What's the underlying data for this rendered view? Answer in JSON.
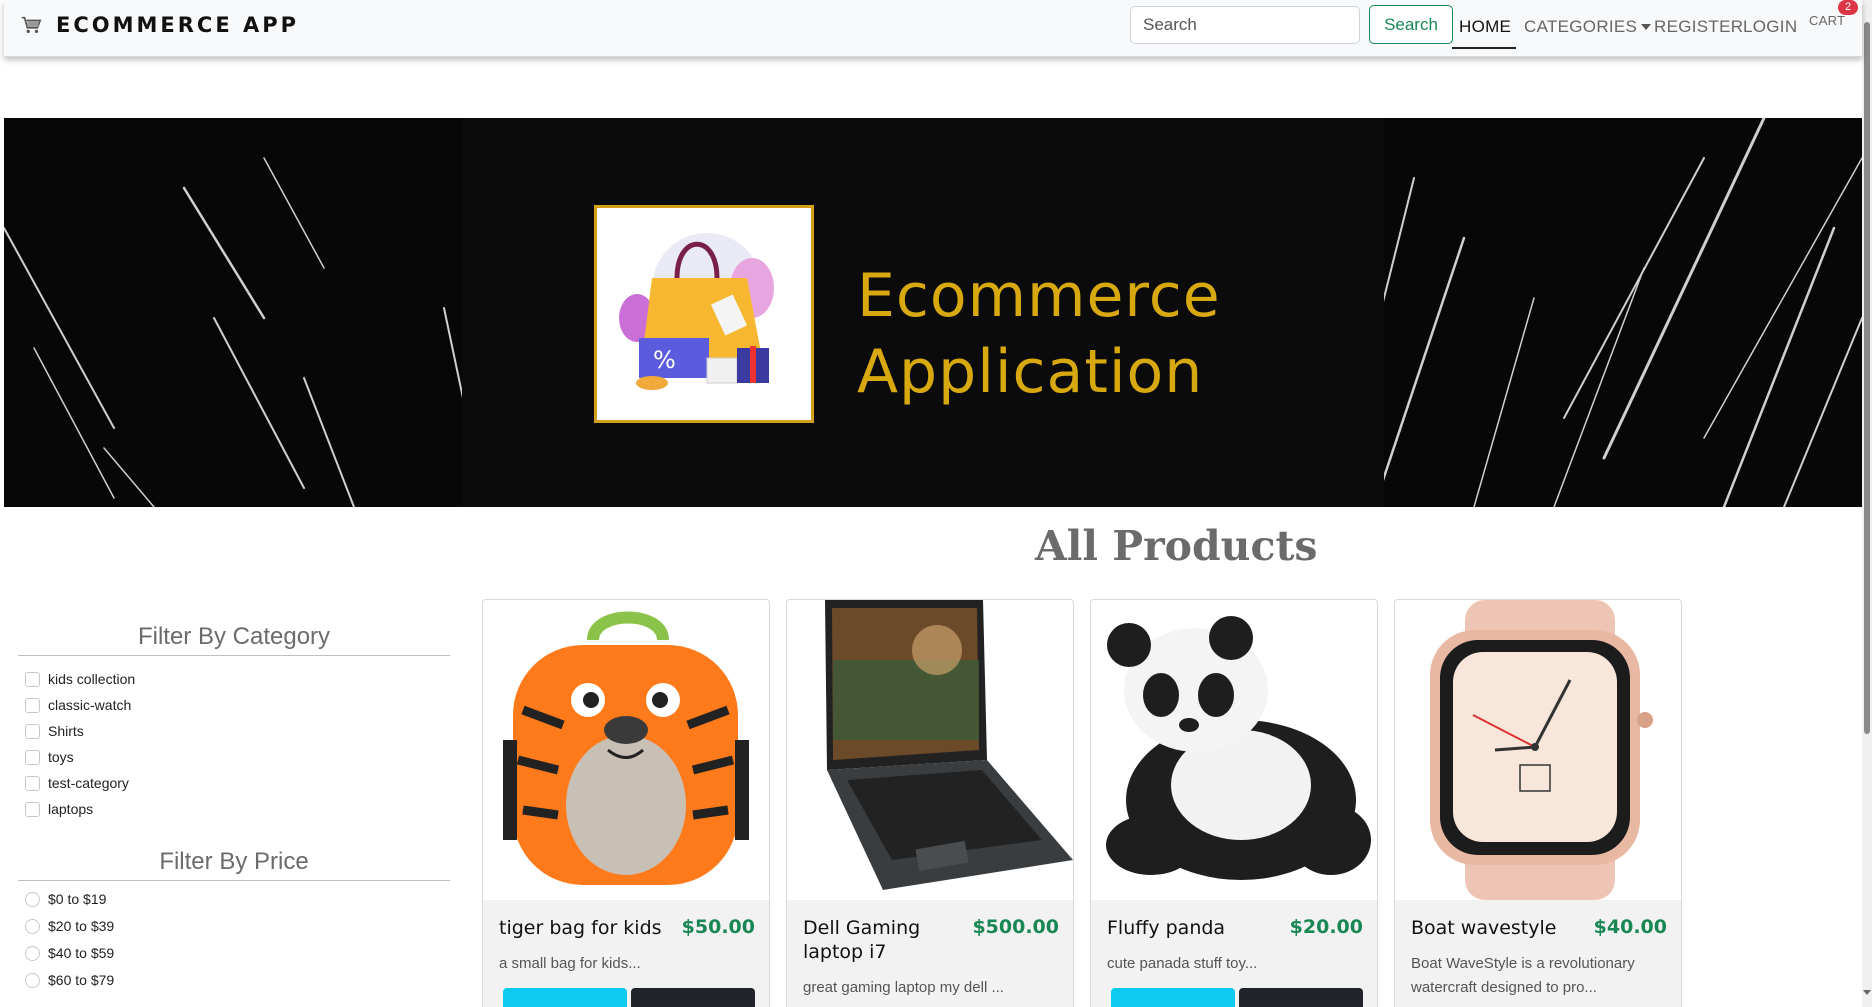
{
  "navbar": {
    "brand": "ECOMMERCE APP",
    "search_placeholder": "Search",
    "search_button": "Search",
    "links": {
      "home": "HOME",
      "categories": "CATEGORIES",
      "register": "REGISTER",
      "login": "LOGIN",
      "cart": "CART"
    },
    "cart_count": "2"
  },
  "banner": {
    "title_line1": "Ecommerce",
    "title_line2": "Application"
  },
  "main": {
    "heading": "All Products"
  },
  "filters": {
    "category_heading": "Filter By Category",
    "categories": [
      "kids collection",
      "classic-watch",
      "Shirts",
      "toys",
      "test-category",
      "laptops"
    ],
    "price_heading": "Filter By Price",
    "prices": [
      "$0 to $19",
      "$20 to $39",
      "$40 to $59",
      "$60 to $79"
    ]
  },
  "products": [
    {
      "name": "tiger bag for kids",
      "price": "$50.00",
      "description": "a small bag for kids..."
    },
    {
      "name": "Dell Gaming laptop i7",
      "price": "$500.00",
      "description": "great gaming laptop my dell ..."
    },
    {
      "name": "Fluffy panda",
      "price": "$20.00",
      "description": "cute panada stuff toy..."
    },
    {
      "name": "Boat wavestyle",
      "price": "$40.00",
      "description": "Boat WaveStyle is a revolutionary watercraft designed to pro..."
    }
  ],
  "colors": {
    "accent_green": "#198754",
    "banner_gold": "#d8a80f",
    "badge_red": "#dc3545",
    "info_cyan": "#0dcaf0"
  }
}
